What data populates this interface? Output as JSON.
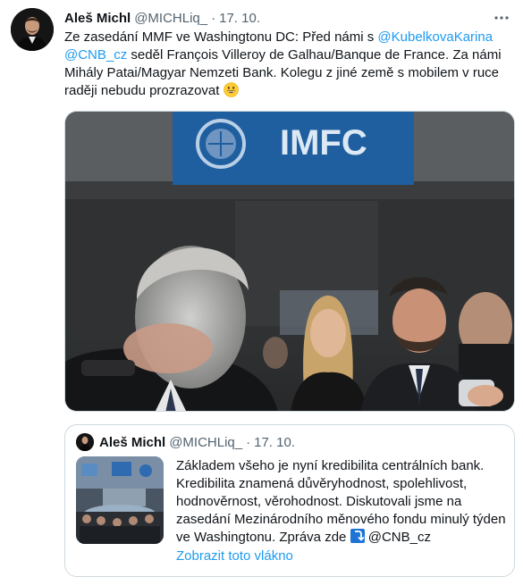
{
  "tweet": {
    "display_name": "Aleš Michl",
    "handle": "@MICHLiq_",
    "separator": "·",
    "time": "17. 10.",
    "text_1": "Ze zasedání MMF ve Washingtonu DC: Před námi s ",
    "mention_1": "@KubelkovaKarina",
    "mention_2": "@CNB_cz",
    "text_2": " seděl François Villeroy de Galhau/Banque de France. Za námi Mihály Patai/Magyar Nemzeti Bank. Kolegu z jiné země s mobilem v ruce raději nebudu prozrazovat ",
    "emoji": "grinning-face-emoji",
    "photo_sign": "IMFC"
  },
  "quote": {
    "display_name": "Aleš Michl",
    "handle": "@MICHLiq_",
    "separator": "·",
    "time": "17. 10.",
    "text": "Základem všeho je nyní kredibilita centrálních bank. Kredibilita znamená důvěryhodnost, spolehlivost, hodnověrnost, věrohodnost. Diskutovali jsme na zasedání Mezinárodního měnového fondu minulý týden ve Washingtonu. Zpráva zde ",
    "arrow_icon": "right-down-arrow-emoji",
    "mention": " @CNB_cz",
    "show_thread": "Zobrazit toto vlákno"
  },
  "colors": {
    "link": "#1d9bf0",
    "secondary_text": "#536471",
    "border": "#cfd9de",
    "imfc_banner": "#1f5fa0"
  }
}
